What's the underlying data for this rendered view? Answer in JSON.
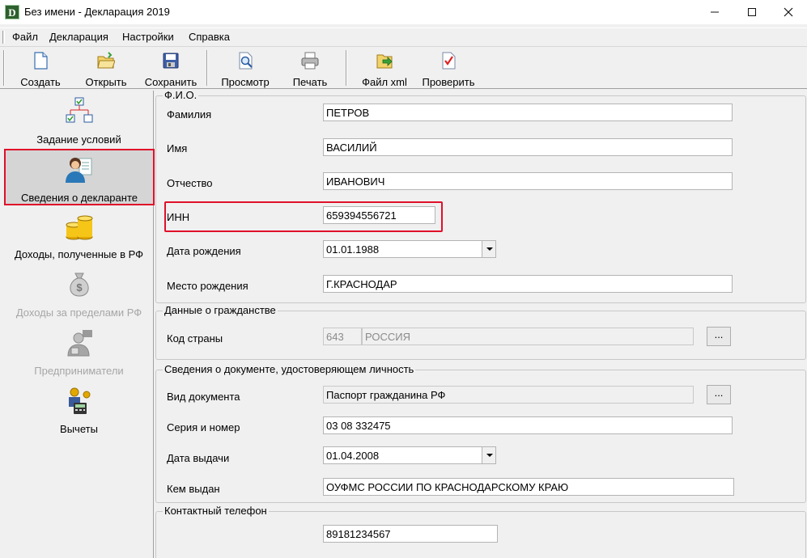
{
  "window": {
    "title": "Без имени - Декларация 2019",
    "app_icon_letter": "D"
  },
  "menu": [
    "Файл",
    "Декларация",
    "Настройки",
    "Справка"
  ],
  "toolbar": {
    "create": "Создать",
    "open": "Открыть",
    "save": "Сохранить",
    "preview": "Просмотр",
    "print": "Печать",
    "xml": "Файл xml",
    "check": "Проверить"
  },
  "nav": [
    {
      "label": "Задание условий",
      "icon": "tree-icon",
      "state": "normal"
    },
    {
      "label": "Сведения о декларанте",
      "icon": "person-icon",
      "state": "active"
    },
    {
      "label": "Доходы, полученные в РФ",
      "icon": "coins-icon",
      "state": "normal"
    },
    {
      "label": "Доходы за пределами РФ",
      "icon": "money-bag-icon",
      "state": "disabled"
    },
    {
      "label": "Предприниматели",
      "icon": "businessman-icon",
      "state": "disabled"
    },
    {
      "label": "Вычеты",
      "icon": "deductions-icon",
      "state": "normal"
    }
  ],
  "fio": {
    "legend": "Ф.И.О.",
    "surname_label": "Фамилия",
    "surname": "ПЕТРОВ",
    "name_label": "Имя",
    "name": "ВАСИЛИЙ",
    "patronymic_label": "Отчество",
    "patronymic": "ИВАНОВИЧ",
    "inn_label": "ИНН",
    "inn": "659394556721",
    "birthdate_label": "Дата рождения",
    "birthdate": "01.01.1988",
    "birthplace_label": "Место рождения",
    "birthplace": "Г.КРАСНОДАР"
  },
  "citizenship": {
    "legend": "Данные о гражданстве",
    "country_label": "Код страны",
    "country_code": "643",
    "country_name": "РОССИЯ",
    "browse": "..."
  },
  "document": {
    "legend": "Сведения о документе, удостоверяющем личность",
    "type_label": "Вид документа",
    "type": "Паспорт гражданина РФ",
    "browse": "...",
    "series_label": "Серия и номер",
    "series": "03 08 332475",
    "issue_date_label": "Дата выдачи",
    "issue_date": "01.04.2008",
    "issued_by_label": "Кем выдан",
    "issued_by": "ОУФМС РОССИИ ПО КРАСНОДАРСКОМУ КРАЮ"
  },
  "contact": {
    "legend": "Контактный телефон",
    "phone": "89181234567"
  },
  "colors": {
    "highlight": "#e0102a",
    "active_nav_bg": "#d5d5d5"
  }
}
